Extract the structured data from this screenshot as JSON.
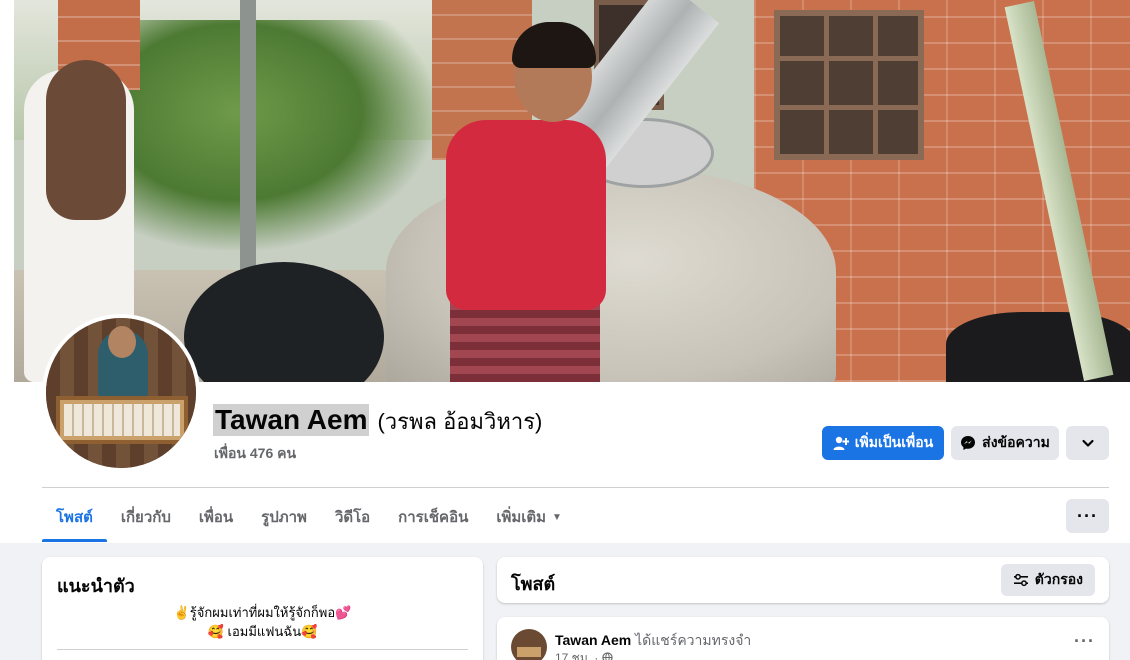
{
  "profile": {
    "name": "Tawan Aem",
    "alternate_name": "(วรพล อ้อมวิหาร)",
    "friends_text": "เพื่อน 476 คน"
  },
  "actions": {
    "add_friend": "เพิ่มเป็นเพื่อน",
    "message": "ส่งข้อความ",
    "more_icon": "chevron-down-icon"
  },
  "tabs": [
    {
      "label": "โพสต์",
      "active": true
    },
    {
      "label": "เกี่ยวกับ",
      "active": false
    },
    {
      "label": "เพื่อน",
      "active": false
    },
    {
      "label": "รูปภาพ",
      "active": false
    },
    {
      "label": "วิดีโอ",
      "active": false
    },
    {
      "label": "การเช็คอิน",
      "active": false
    },
    {
      "label": "เพิ่มเติม",
      "active": false
    }
  ],
  "tabs_more_button": "···",
  "intro": {
    "title": "แนะนำตัว",
    "bio_line1": "✌️รู้จักผมเท่าที่ผมให้รู้จักก็พอ💕",
    "bio_line2": "🥰 เอมมีแฟนฉัน🥰"
  },
  "posts": {
    "title": "โพสต์",
    "filter_label": "ตัวกรอง"
  },
  "post": {
    "author": "Tawan Aem",
    "action": "ได้แชร์ความทรงจำ",
    "time": "17 ชม. ·",
    "more": "···"
  },
  "colors": {
    "accent": "#1b74e4",
    "secondary_button": "#e4e6eb",
    "page_background": "#f0f2f5"
  }
}
